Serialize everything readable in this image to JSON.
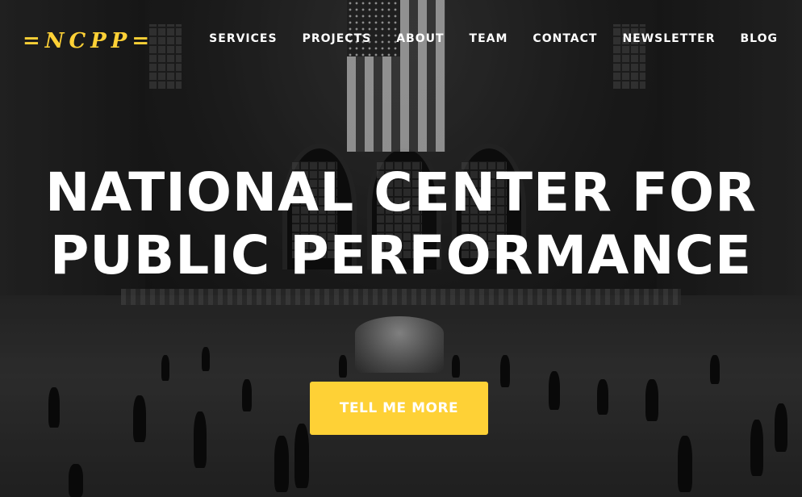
{
  "brand": {
    "logo_text": "=NCPP=",
    "accent_color": "#fed136"
  },
  "nav": {
    "items": [
      {
        "label": "SERVICES"
      },
      {
        "label": "PROJECTS"
      },
      {
        "label": "ABOUT"
      },
      {
        "label": "TEAM"
      },
      {
        "label": "CONTACT"
      },
      {
        "label": "NEWSLETTER"
      },
      {
        "label": "BLOG"
      }
    ]
  },
  "hero": {
    "headline_line1": "NATIONAL CENTER FOR",
    "headline_line2": "PUBLIC PERFORMANCE",
    "cta_label": "TELL ME MORE"
  }
}
